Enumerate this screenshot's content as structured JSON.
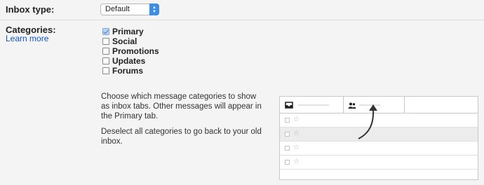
{
  "inbox_type": {
    "label": "Inbox type:",
    "selected": "Default"
  },
  "categories": {
    "label": "Categories:",
    "learn_more": "Learn more",
    "items": [
      {
        "label": "Primary",
        "checked": true
      },
      {
        "label": "Social",
        "checked": false
      },
      {
        "label": "Promotions",
        "checked": false
      },
      {
        "label": "Updates",
        "checked": false
      },
      {
        "label": "Forums",
        "checked": false
      }
    ],
    "description_1": "Choose which message categories to show as inbox tabs. Other messages will appear in the Primary tab.",
    "description_2": "Deselect all categories to go back to your old inbox."
  },
  "illustration": {
    "tabs": [
      {
        "icon": "inbox-icon"
      },
      {
        "icon": "people-icon"
      }
    ],
    "rows": [
      {
        "shaded": false
      },
      {
        "shaded": true
      },
      {
        "shaded": false
      },
      {
        "shaded": false
      }
    ]
  },
  "colors": {
    "link": "#1155cc",
    "select_accent": "#3a8ee6",
    "background": "#f4f4f4"
  }
}
